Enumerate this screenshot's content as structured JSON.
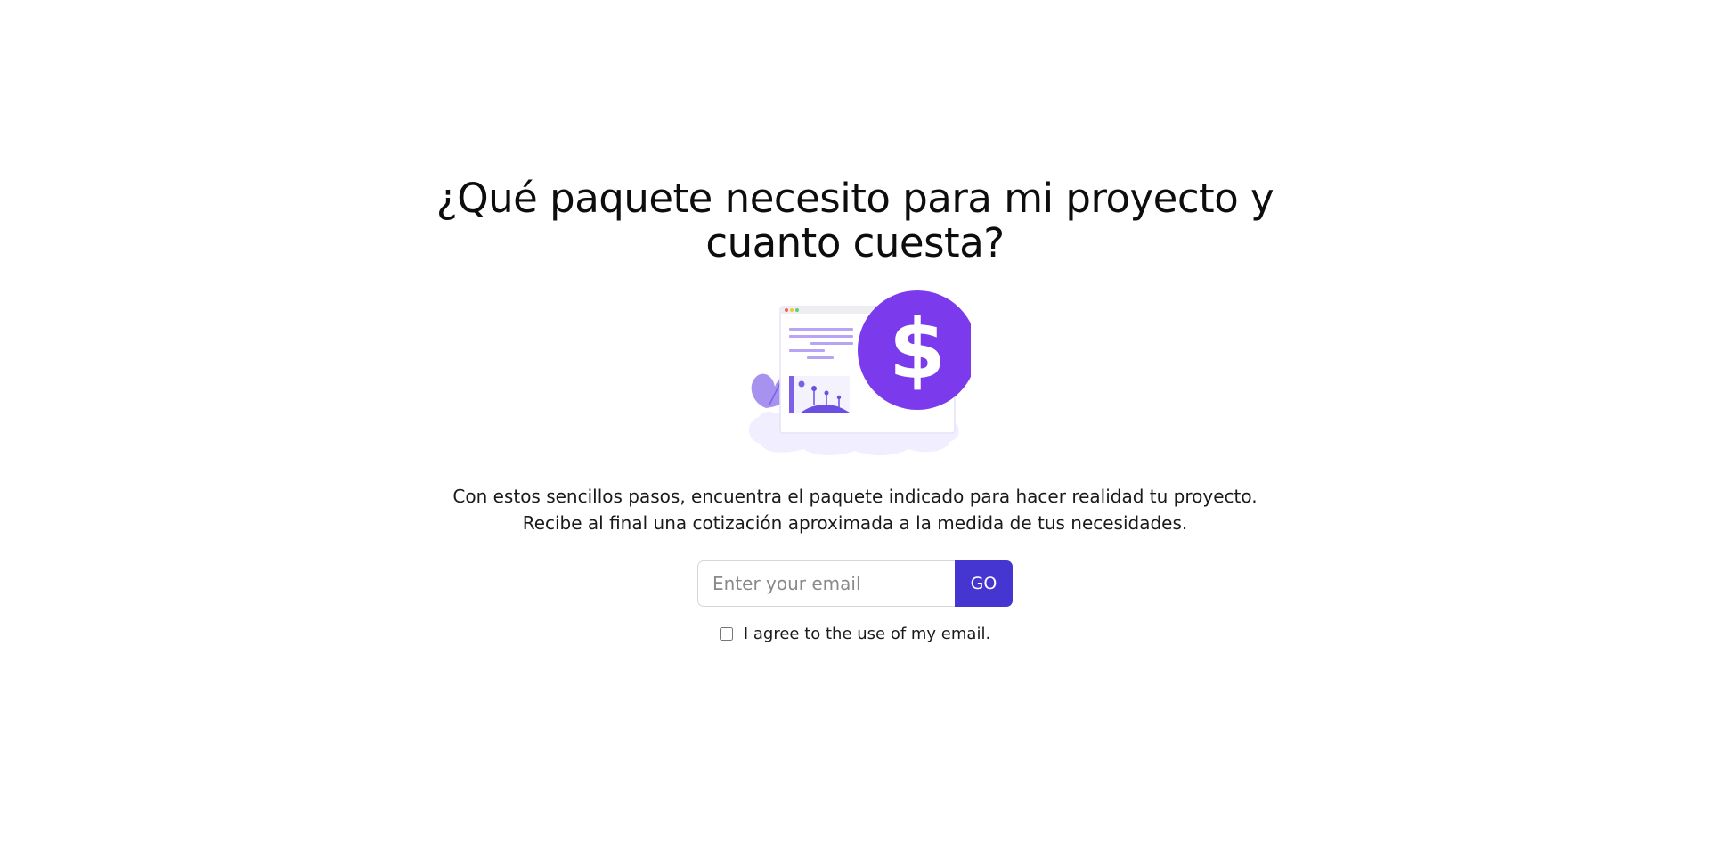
{
  "hero": {
    "title": "¿Qué paquete necesito para mi proyecto y cuanto cuesta?",
    "description_line1": "Con estos sencillos pasos, encuentra el paquete indicado para hacer realidad tu proyecto.",
    "description_line2": "Recibe al final una cotización aproximada a la medida de tus necesidades.",
    "illustration_symbol": "$",
    "illustration_icon": "pricing-illustration-icon"
  },
  "signup": {
    "email_placeholder": "Enter your email",
    "email_value": "",
    "submit_label": "GO",
    "consent_label": "I agree to the use of my email.",
    "consent_checked": false
  },
  "colors": {
    "accent": "#7c3aed",
    "button": "#4536d1",
    "illustration_light": "#b8a4f5",
    "illustration_bg": "#f1efff"
  }
}
